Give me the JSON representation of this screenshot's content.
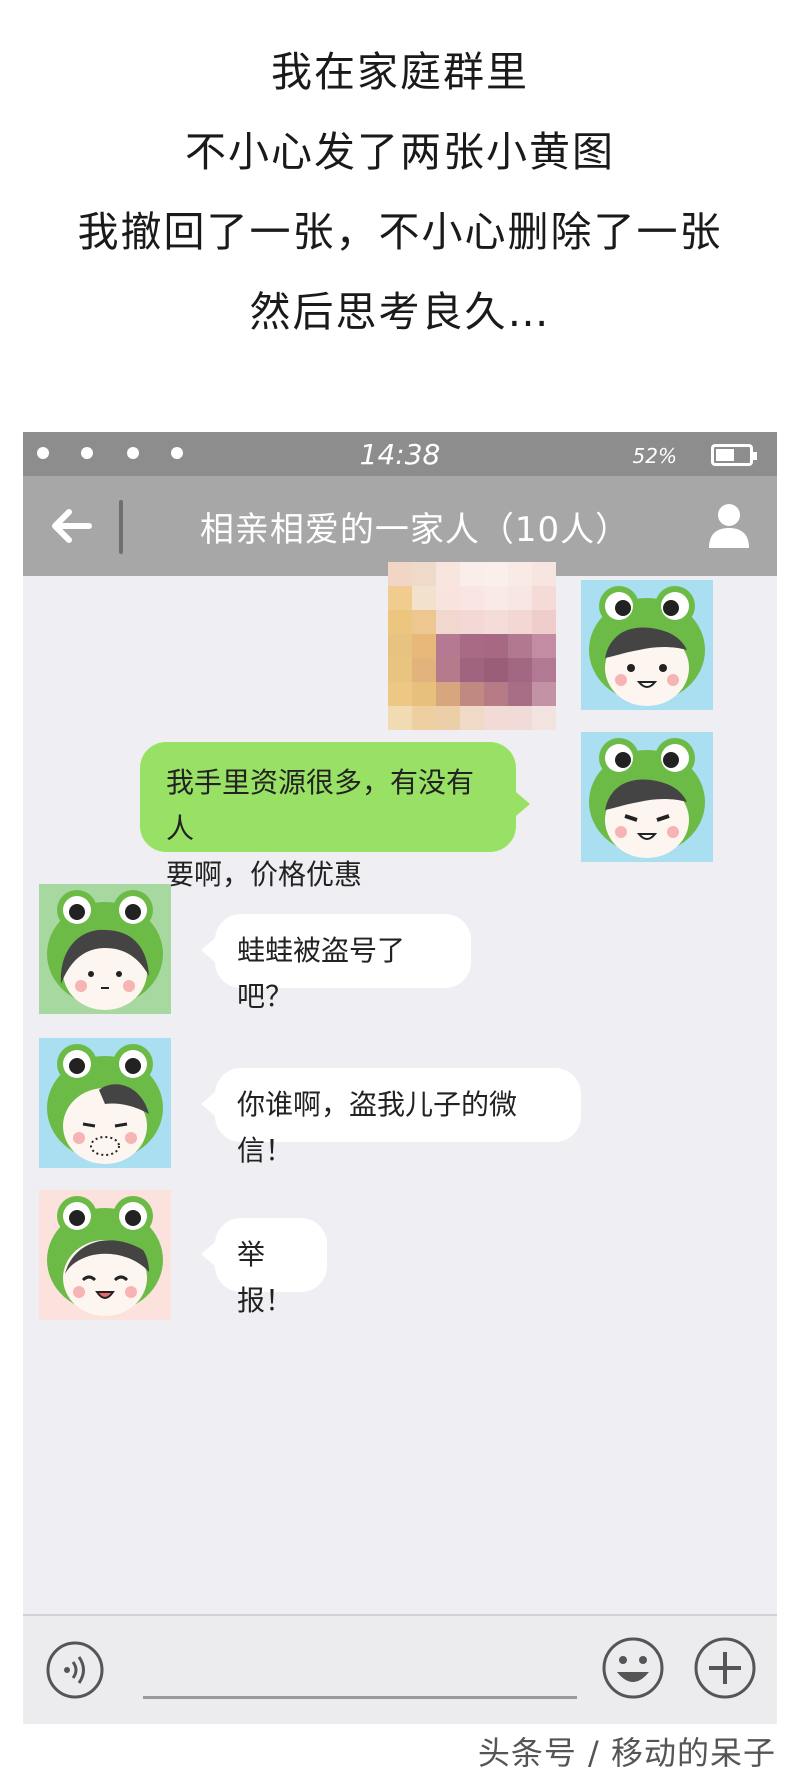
{
  "caption": {
    "lines": [
      "我在家庭群里",
      "不小心发了两张小黄图",
      "我撤回了一张，不小心删除了一张",
      "然后思考良久…"
    ]
  },
  "status_bar": {
    "time": "14:38",
    "battery_percent": "52%"
  },
  "header": {
    "back_icon": "arrow-left-icon",
    "title": "相亲相爱的一家人（10人）",
    "profile_icon": "person-icon"
  },
  "messages": [
    {
      "side": "sent",
      "type": "image",
      "content": "pixelated-image"
    },
    {
      "side": "sent",
      "type": "text",
      "lines": [
        "我手里资源很多，有没有人",
        "要啊，价格优惠"
      ]
    },
    {
      "side": "received",
      "type": "text",
      "text": "蛙蛙被盗号了吧？"
    },
    {
      "side": "received",
      "type": "text",
      "text": "你谁啊，盗我儿子的微信！"
    },
    {
      "side": "received",
      "type": "text",
      "text": "举报！"
    }
  ],
  "input_bar": {
    "voice_icon": "voice-icon",
    "emoji_icon": "emoji-icon",
    "more_icon": "plus-icon"
  },
  "watermark": "头条号 / 移动的呆子",
  "colors": {
    "sent_bubble": "#98e165",
    "received_bubble": "#ffffff",
    "header_bg": "#a7a7a7",
    "chat_bg": "#efeff3",
    "frog_green": "#6dbb47"
  }
}
